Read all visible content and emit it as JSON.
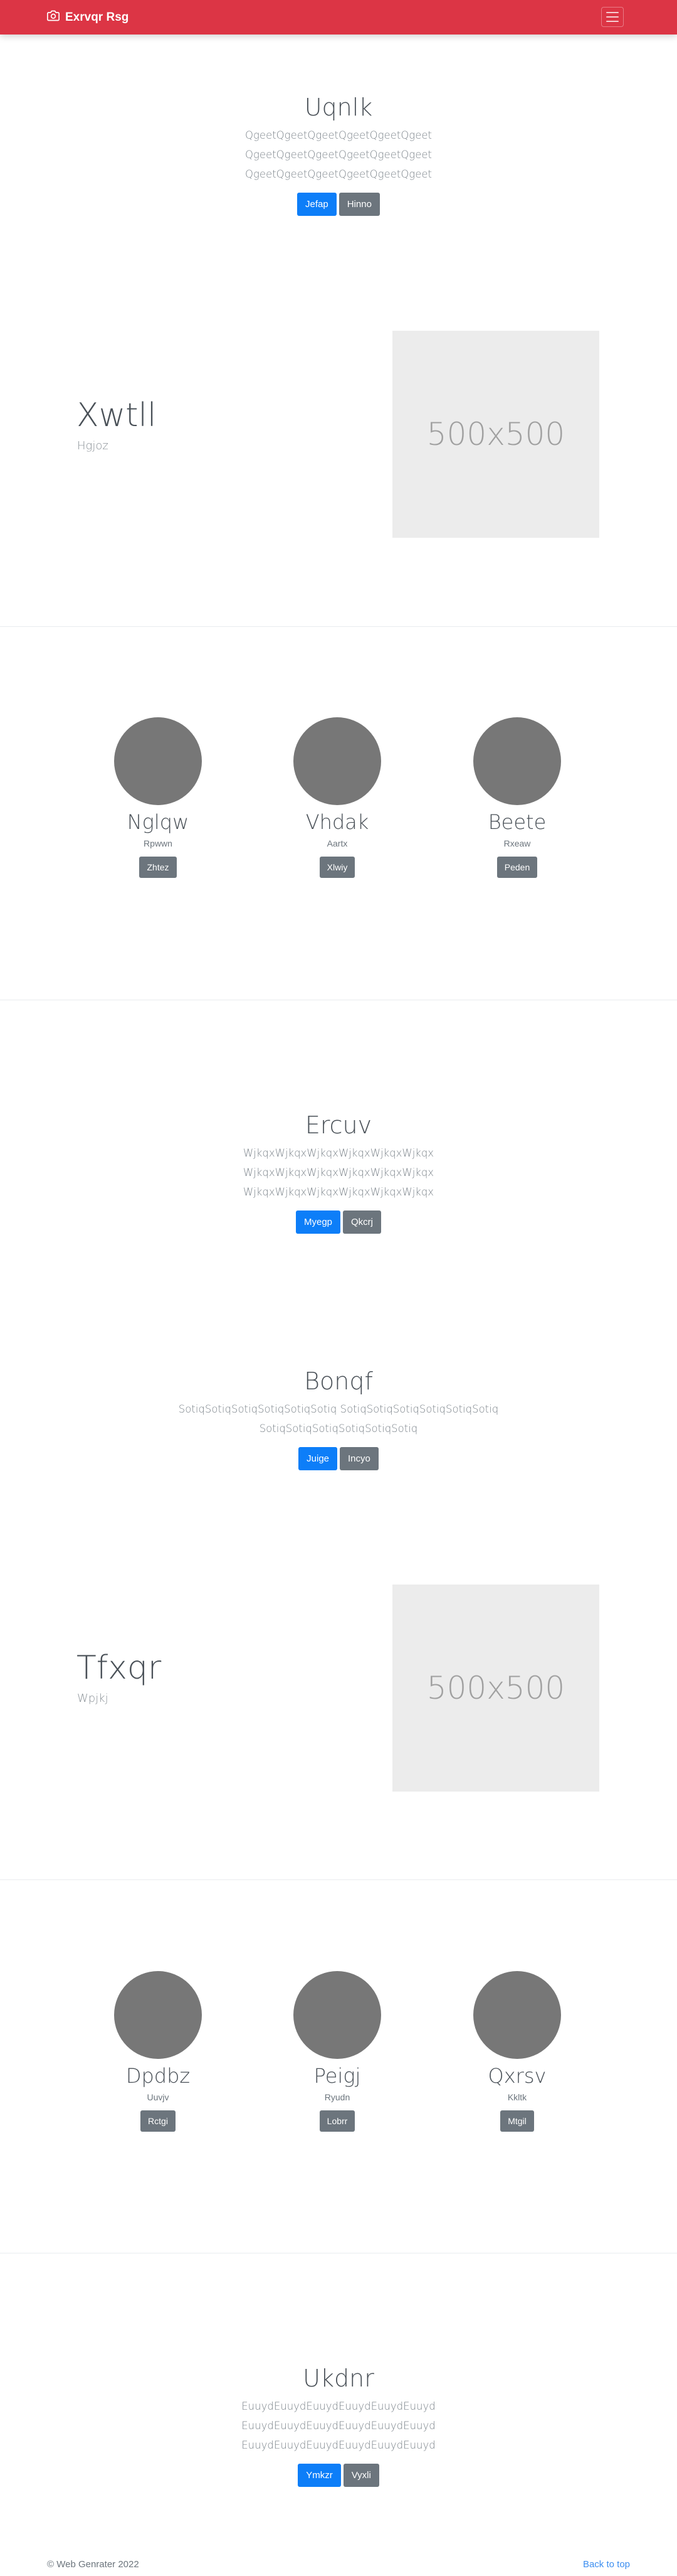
{
  "navbar": {
    "brand": "Exrvqr Rsg",
    "camera_icon": "camera-icon",
    "toggler_icon": "menu-icon"
  },
  "hero1": {
    "title": "Uqnlk",
    "lines": [
      "QgeetQgeetQgeetQgeetQgeetQgeet",
      "QgeetQgeetQgeetQgeetQgeetQgeet",
      "QgeetQgeetQgeetQgeetQgeetQgeet"
    ],
    "primary": "Jefap",
    "secondary": "Hinno"
  },
  "feature1": {
    "title": "Xwtll",
    "subtitle": "Hgjoz",
    "placeholder": "500x500"
  },
  "team1": [
    {
      "name": "Nglqw",
      "role": "Rpwwn",
      "button": "Zhtez"
    },
    {
      "name": "Vhdak",
      "role": "Aartx",
      "button": "Xlwiy"
    },
    {
      "name": "Beete",
      "role": "Rxeaw",
      "button": "Peden"
    }
  ],
  "hero2": {
    "title": "Ercuv",
    "lines": [
      "WjkqxWjkqxWjkqxWjkqxWjkqxWjkqx",
      "WjkqxWjkqxWjkqxWjkqxWjkqxWjkqx",
      "WjkqxWjkqxWjkqxWjkqxWjkqxWjkqx"
    ],
    "primary": "Myegp",
    "secondary": "Qkcrj"
  },
  "hero3": {
    "title": "Bonqf",
    "lines": [
      "SotiqSotiqSotiqSotiqSotiqSotiq SotiqSotiqSotiqSotiqSotiqSotiq",
      "SotiqSotiqSotiqSotiqSotiqSotiq"
    ],
    "primary": "Juige",
    "secondary": "Incyo"
  },
  "feature2": {
    "title": "Tfxqr",
    "subtitle": "Wpjkj",
    "placeholder": "500x500"
  },
  "team2": [
    {
      "name": "Dpdbz",
      "role": "Uuvjv",
      "button": "Rctgi"
    },
    {
      "name": "Peigj",
      "role": "Ryudn",
      "button": "Lobrr"
    },
    {
      "name": "Qxrsv",
      "role": "Kkltk",
      "button": "Mtgil"
    }
  ],
  "hero4": {
    "title": "Ukdnr",
    "lines": [
      "EuuydEuuydEuuydEuuydEuuydEuuyd",
      "EuuydEuuydEuuydEuuydEuuydEuuyd",
      "EuuydEuuydEuuydEuuydEuuydEuuyd"
    ],
    "primary": "Ymkzr",
    "secondary": "Vyxli"
  },
  "footer": {
    "copyright": "© Web Genrater 2022",
    "back_to_top": "Back to top"
  },
  "colors": {
    "navbar": "#dc3545",
    "primary": "#0d7ef8",
    "secondary": "#6c757d",
    "placeholder_bg": "#ececec",
    "avatar": "#777777"
  }
}
